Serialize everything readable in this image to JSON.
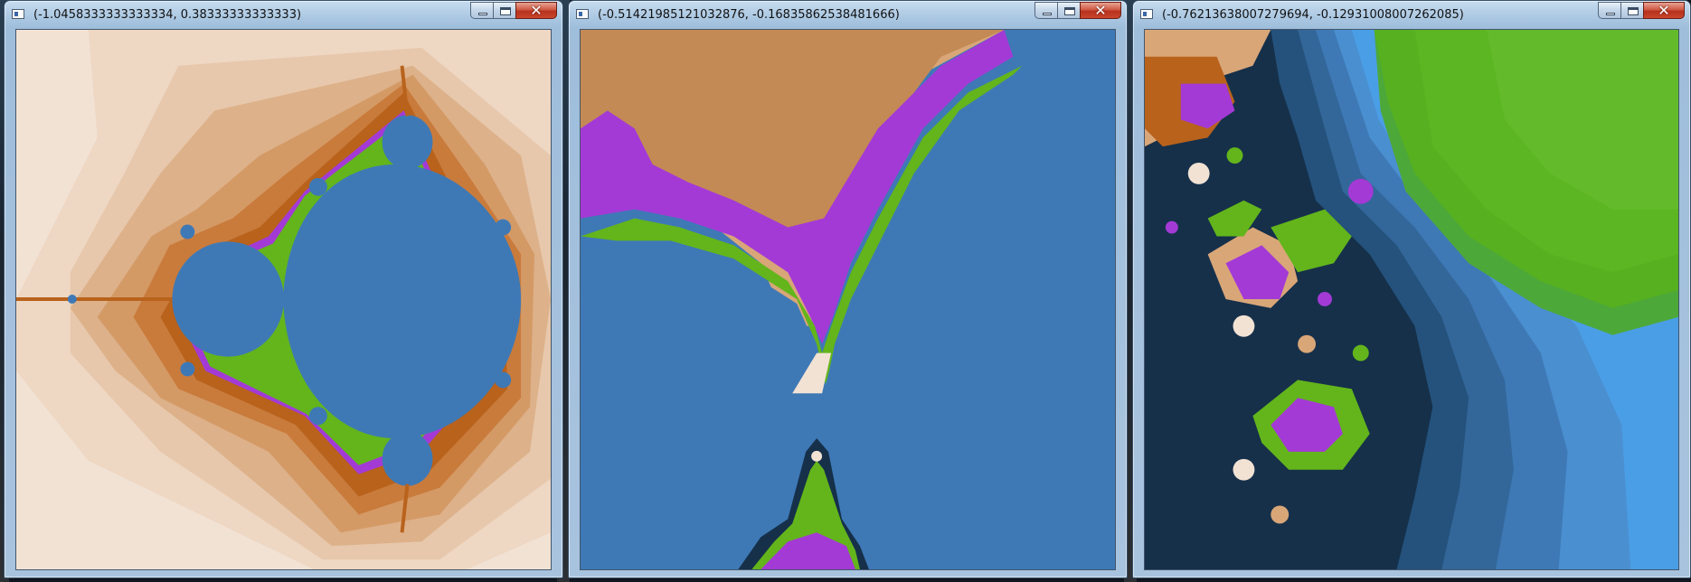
{
  "windows": [
    {
      "title": "(-1.0458333333333334, 0.38333333333333)",
      "controls": {
        "minimize": "minimize-icon",
        "maximize": "maximize-icon",
        "close": "close-icon"
      },
      "view": "full Mandelbrot set"
    },
    {
      "title": "(-0.51421985121032876, -0.16835862538481666)",
      "controls": {
        "minimize": "minimize-icon",
        "maximize": "maximize-icon",
        "close": "close-icon"
      },
      "view": "zoom seahorse valley"
    },
    {
      "title": "(-0.76213638007279694, -0.12931008007262085)",
      "controls": {
        "minimize": "minimize-icon",
        "maximize": "maximize-icon",
        "close": "close-icon"
      },
      "view": "deep zoom spirals"
    }
  ],
  "colors": {
    "set_interior": "#3e79b6",
    "tan_light": "#f2e2d4",
    "tan_mid": "#d9a678",
    "brown": "#b8621c",
    "magenta": "#a33ad6",
    "green": "#63b51b",
    "blue_band": "#4a9ee6",
    "dark_band": "#16304a"
  }
}
